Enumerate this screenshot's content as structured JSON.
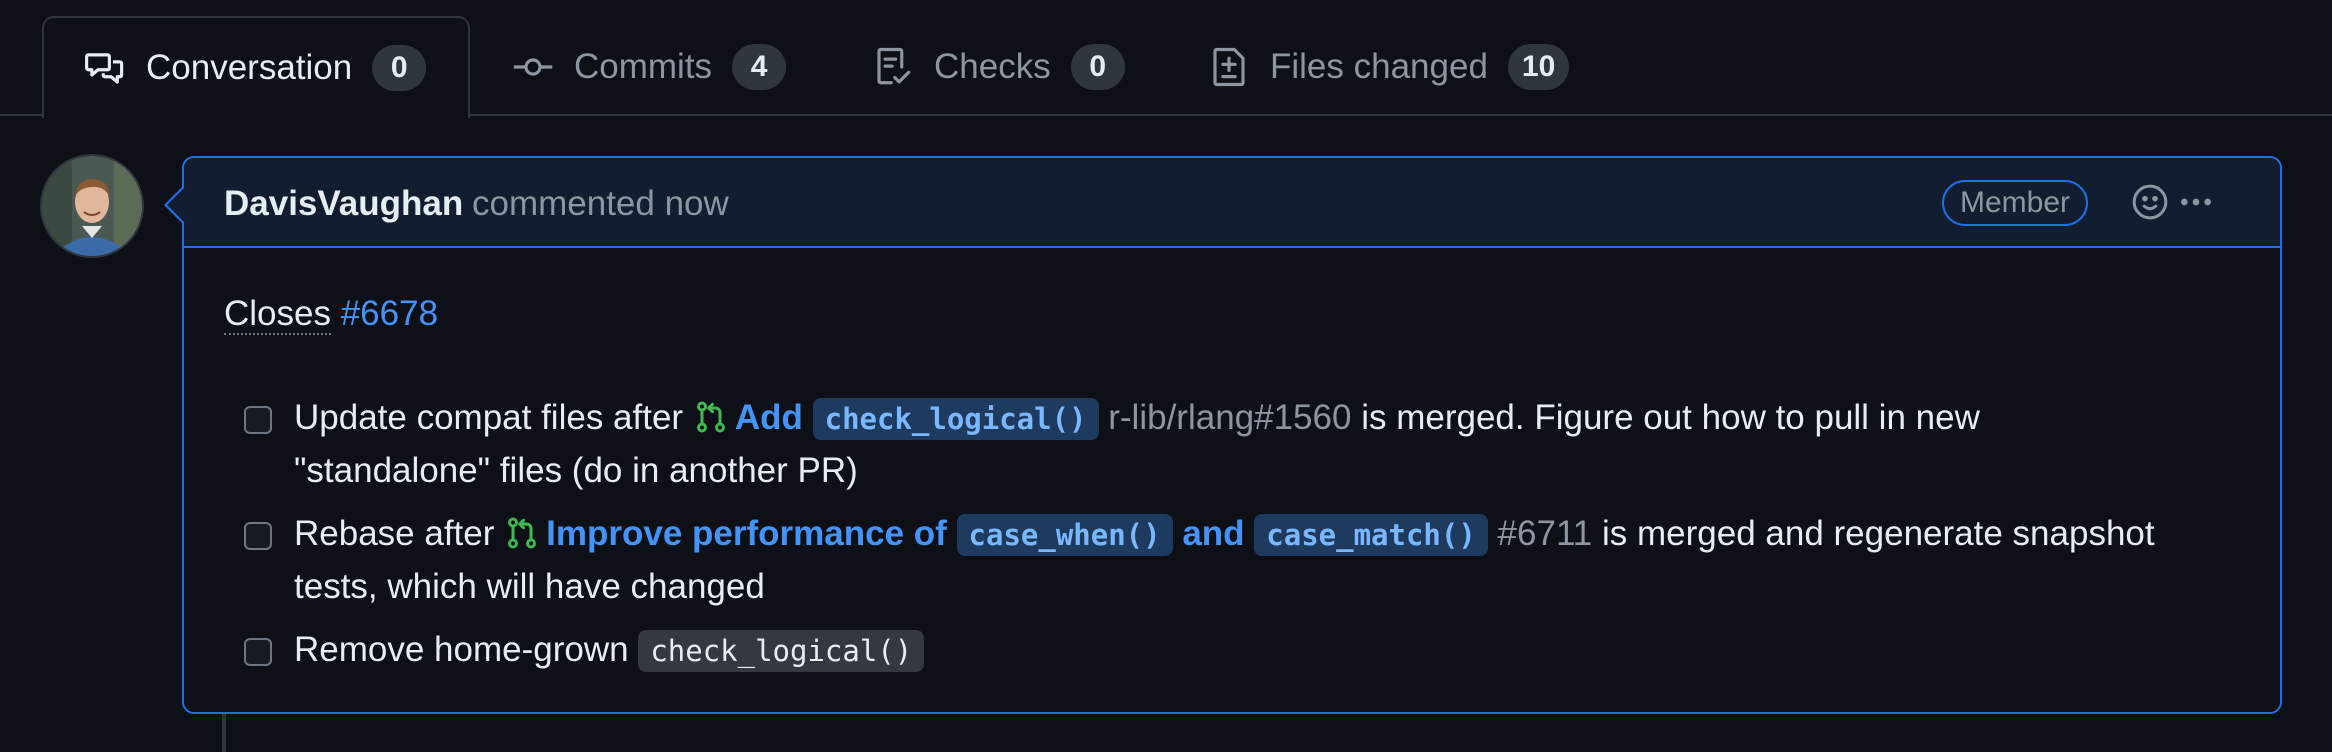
{
  "tabs": [
    {
      "label": "Conversation",
      "count": "0",
      "icon": "comment-discussion-icon"
    },
    {
      "label": "Commits",
      "count": "4",
      "icon": "git-commit-icon"
    },
    {
      "label": "Checks",
      "count": "0",
      "icon": "checklist-icon"
    },
    {
      "label": "Files changed",
      "count": "10",
      "icon": "file-diff-icon"
    }
  ],
  "comment": {
    "author": "DavisVaughan",
    "meta": "commented now",
    "role_badge": "Member",
    "closes_label": "Closes",
    "closes_issue": "#6678",
    "tasks": [
      {
        "pre": "Update compat files after",
        "link_text": "Add",
        "link_code": "check_logical()",
        "ref": "r-lib/rlang#1560",
        "post_line1": "is merged. Figure out how to pull in new",
        "post_line2": "\"standalone\" files (do in another PR)"
      },
      {
        "pre": "Rebase after",
        "link_text": "Improve performance of",
        "link_code_1": "case_when()",
        "link_and": "and",
        "link_code_2": "case_match()",
        "ref": "#6711",
        "post_line1": "is merged and regenerate snapshot",
        "post_line2": "tests, which will have changed"
      },
      {
        "pre": "Remove home-grown",
        "code": "check_logical()"
      }
    ]
  },
  "colors": {
    "background": "#0d1117",
    "accent_link": "#4493f8",
    "pr_open_green": "#3fb950",
    "comment_border": "#1f6feb"
  }
}
